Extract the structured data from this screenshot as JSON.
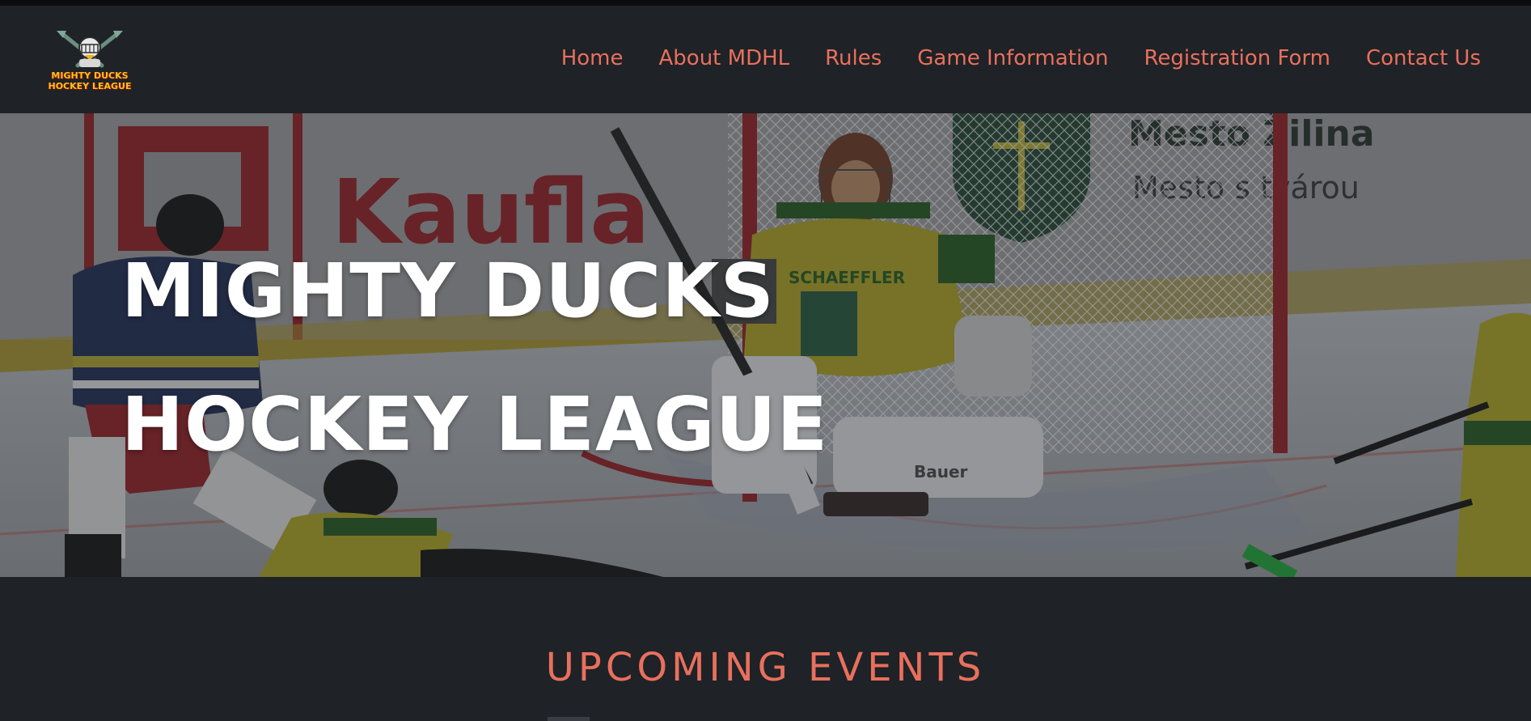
{
  "logo": {
    "line1": "MIGHTY DUCKS",
    "line2": "HOCKEY LEAGUE"
  },
  "nav": {
    "items": [
      {
        "label": "Home"
      },
      {
        "label": "About MDHL"
      },
      {
        "label": "Rules"
      },
      {
        "label": "Game Information"
      },
      {
        "label": "Registration Form"
      },
      {
        "label": "Contact Us"
      }
    ]
  },
  "hero": {
    "title_line1": "MIGHTY DUCKS",
    "title_line2": "HOCKEY LEAGUE"
  },
  "events": {
    "heading": "UPCOMING EVENTS"
  },
  "colors": {
    "background": "#1f2226",
    "accent": "#e8705e",
    "hero_text": "#ffffff"
  }
}
